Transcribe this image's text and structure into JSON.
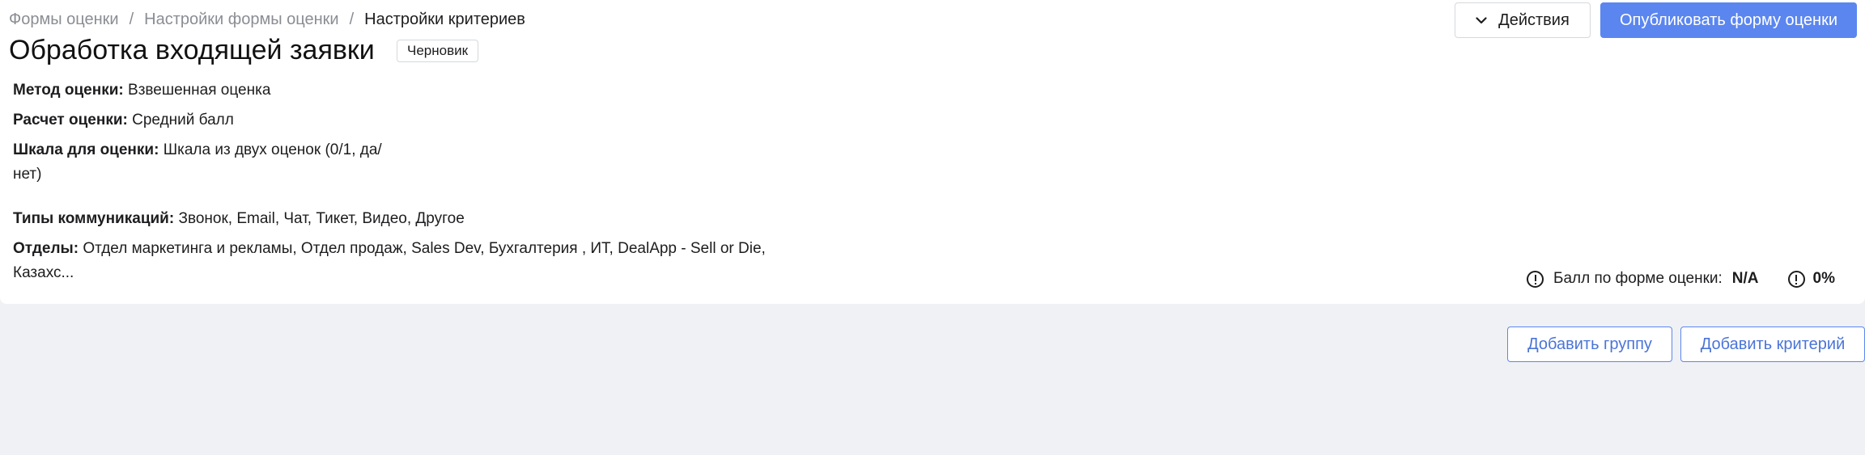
{
  "breadcrumb": {
    "items": [
      "Формы оценки",
      "Настройки формы оценки",
      "Настройки критериев"
    ],
    "separator": "/"
  },
  "page": {
    "title": "Обработка входящей заявки",
    "status_badge": "Черновик"
  },
  "header_actions": {
    "actions_label": "Действия",
    "publish_label": "Опубликовать форму оценки"
  },
  "info": {
    "method": {
      "label": "Метод оценки:",
      "value": "Взвешенная оценка"
    },
    "calculation": {
      "label": "Расчет оценки:",
      "value": "Средний балл"
    },
    "scale": {
      "label": "Шкала для оценки:",
      "value_line1": "Шкала из двух оценок (0/1, да/",
      "value_line2": "нет)"
    },
    "comm_types": {
      "label": "Типы коммуникаций:",
      "value": "Звонок, Email, Чат, Тикет, Видео, Другое"
    },
    "departments": {
      "label": "Отделы:",
      "value_line1": "Отдел маркетинга и рекламы, Отдел продаж, Sales Dev, Бухгалтерия , ИТ, DealApp - Sell or Die,",
      "value_line2": "Казахс..."
    }
  },
  "score": {
    "label": "Балл по форме оценки:",
    "value": "N/A",
    "percent": "0%"
  },
  "bottom_actions": {
    "add_group": "Добавить группу",
    "add_criterion": "Добавить критерий"
  },
  "colors": {
    "primary": "#5b86f0",
    "background": "#f0f1f5",
    "muted_text": "#8a8d93"
  }
}
